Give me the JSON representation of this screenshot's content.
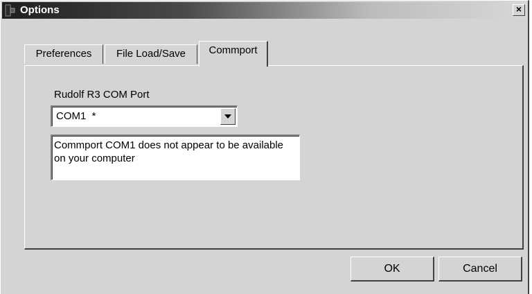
{
  "window": {
    "title": "Options",
    "close_label": "×"
  },
  "tabs": [
    {
      "label": "Preferences",
      "selected": false
    },
    {
      "label": "File Load/Save",
      "selected": false
    },
    {
      "label": "Commport",
      "selected": true
    }
  ],
  "commport": {
    "port_label": "Rudolf R3 COM Port",
    "port_value": "COM1  *",
    "message": "Commport COM1 does not appear to be available on your computer"
  },
  "buttons": {
    "ok_label": "OK",
    "cancel_label": "Cancel"
  },
  "icons": {
    "app": "app-icon",
    "close": "close-icon",
    "dropdown": "chevron-down-icon"
  },
  "colors": {
    "face": "#d4d4d4",
    "titlebar_dark": "#1e1e1e",
    "titlebar_light": "#d8d8d8",
    "highlight": "#ffffff",
    "shadow": "#404040"
  }
}
